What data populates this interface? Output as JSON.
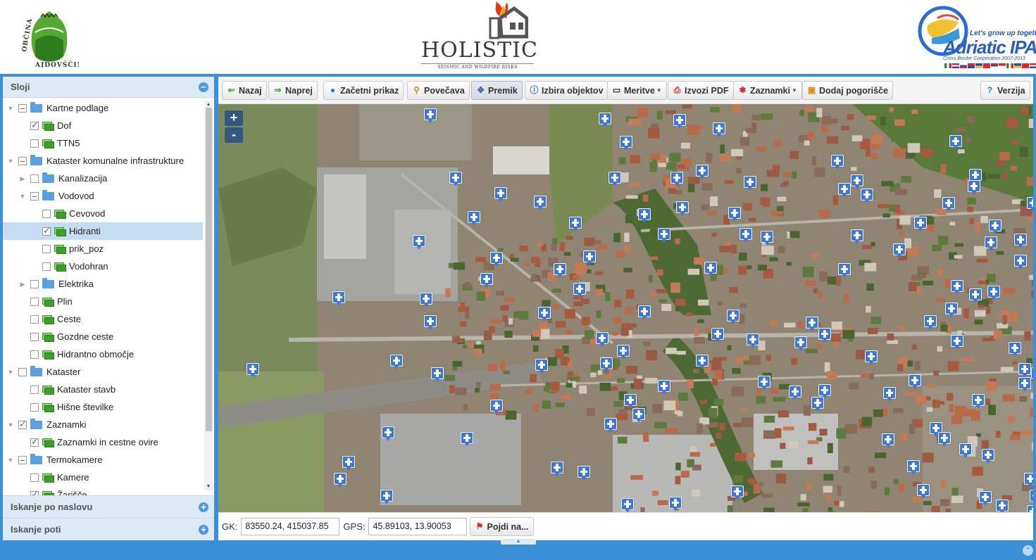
{
  "header": {
    "left_logo_text": "OBČINA AJDOVŠČINA",
    "center_logo_title": "HOLISTIC",
    "center_logo_subtitle": "SEISMIC AND WILDFIRE RISKS",
    "right_logo_tagline": "Let's grow up together",
    "right_logo_title": "Adriatic IPA",
    "right_logo_subtitle": "Cross Border Cooperation 2007-2013"
  },
  "sidebar": {
    "layers_title": "Sloji",
    "tree": [
      {
        "label": "Kartne podlage",
        "depth": 0,
        "kind": "folder",
        "state": "partial",
        "expander": "open"
      },
      {
        "label": "Dof",
        "depth": 1,
        "kind": "layer",
        "state": "checked",
        "expander": "none"
      },
      {
        "label": "TTN5",
        "depth": 1,
        "kind": "layer",
        "state": "unchecked",
        "expander": "none"
      },
      {
        "label": "Kataster komunalne infrastrukture",
        "depth": 0,
        "kind": "folder",
        "state": "partial",
        "expander": "open"
      },
      {
        "label": "Kanalizacija",
        "depth": 1,
        "kind": "folder",
        "state": "unchecked",
        "expander": "closed"
      },
      {
        "label": "Vodovod",
        "depth": 1,
        "kind": "folder",
        "state": "partial",
        "expander": "open"
      },
      {
        "label": "Cevovod",
        "depth": 2,
        "kind": "layer",
        "state": "unchecked",
        "expander": "none"
      },
      {
        "label": "Hidranti",
        "depth": 2,
        "kind": "layer",
        "state": "checked",
        "expander": "none",
        "selected": true
      },
      {
        "label": "prik_poz",
        "depth": 2,
        "kind": "layer",
        "state": "unchecked",
        "expander": "none"
      },
      {
        "label": "Vodohran",
        "depth": 2,
        "kind": "layer",
        "state": "unchecked",
        "expander": "none"
      },
      {
        "label": "Elektrika",
        "depth": 1,
        "kind": "folder",
        "state": "unchecked",
        "expander": "closed"
      },
      {
        "label": "Plin",
        "depth": 1,
        "kind": "layer",
        "state": "unchecked",
        "expander": "none"
      },
      {
        "label": "Ceste",
        "depth": 1,
        "kind": "layer",
        "state": "unchecked",
        "expander": "none"
      },
      {
        "label": "Gozdne ceste",
        "depth": 1,
        "kind": "layer",
        "state": "unchecked",
        "expander": "none"
      },
      {
        "label": "Hidrantno območje",
        "depth": 1,
        "kind": "layer",
        "state": "unchecked",
        "expander": "none"
      },
      {
        "label": "Kataster",
        "depth": 0,
        "kind": "folder",
        "state": "unchecked",
        "expander": "open"
      },
      {
        "label": "Kataster stavb",
        "depth": 1,
        "kind": "layer",
        "state": "unchecked",
        "expander": "none"
      },
      {
        "label": "Hišne številke",
        "depth": 1,
        "kind": "layer",
        "state": "unchecked",
        "expander": "none"
      },
      {
        "label": "Zaznamki",
        "depth": 0,
        "kind": "folder",
        "state": "checked",
        "expander": "open"
      },
      {
        "label": "Zaznamki in cestne ovire",
        "depth": 1,
        "kind": "layer",
        "state": "checked",
        "expander": "none"
      },
      {
        "label": "Termokamere",
        "depth": 0,
        "kind": "folder",
        "state": "partial",
        "expander": "open"
      },
      {
        "label": "Kamere",
        "depth": 1,
        "kind": "layer",
        "state": "unchecked",
        "expander": "none"
      },
      {
        "label": "Žarišče",
        "depth": 1,
        "kind": "layer",
        "state": "checked",
        "expander": "none"
      }
    ],
    "search_address_title": "Iskanje po naslovu",
    "search_route_title": "Iskanje poti"
  },
  "toolbar": {
    "back": "Nazaj",
    "forward": "Naprej",
    "initial_view": "Začetni prikaz",
    "zoom": "Povečava",
    "pan": "Premik",
    "select_objects": "Izbira objektov",
    "measure": "Meritve",
    "export_pdf": "Izvozi PDF",
    "markers": "Zaznamki",
    "add_fire": "Dodaj pogorišče",
    "version": "Verzija"
  },
  "map": {
    "zoom_in": "+",
    "zoom_out": "-",
    "hydrant_marker_count": 112
  },
  "coords": {
    "gk_label": "GK:",
    "gk_value": "83550.24, 415037.85",
    "gps_label": "GPS:",
    "gps_value": "45.89103, 13.90053",
    "go_button": "Pojdi na..."
  },
  "colors": {
    "frame_blue": "#3a8fd6",
    "panel_header": "#dde9f5",
    "selected_row": "#c6dcf2",
    "hydrant_marker": "#3d78d8"
  }
}
